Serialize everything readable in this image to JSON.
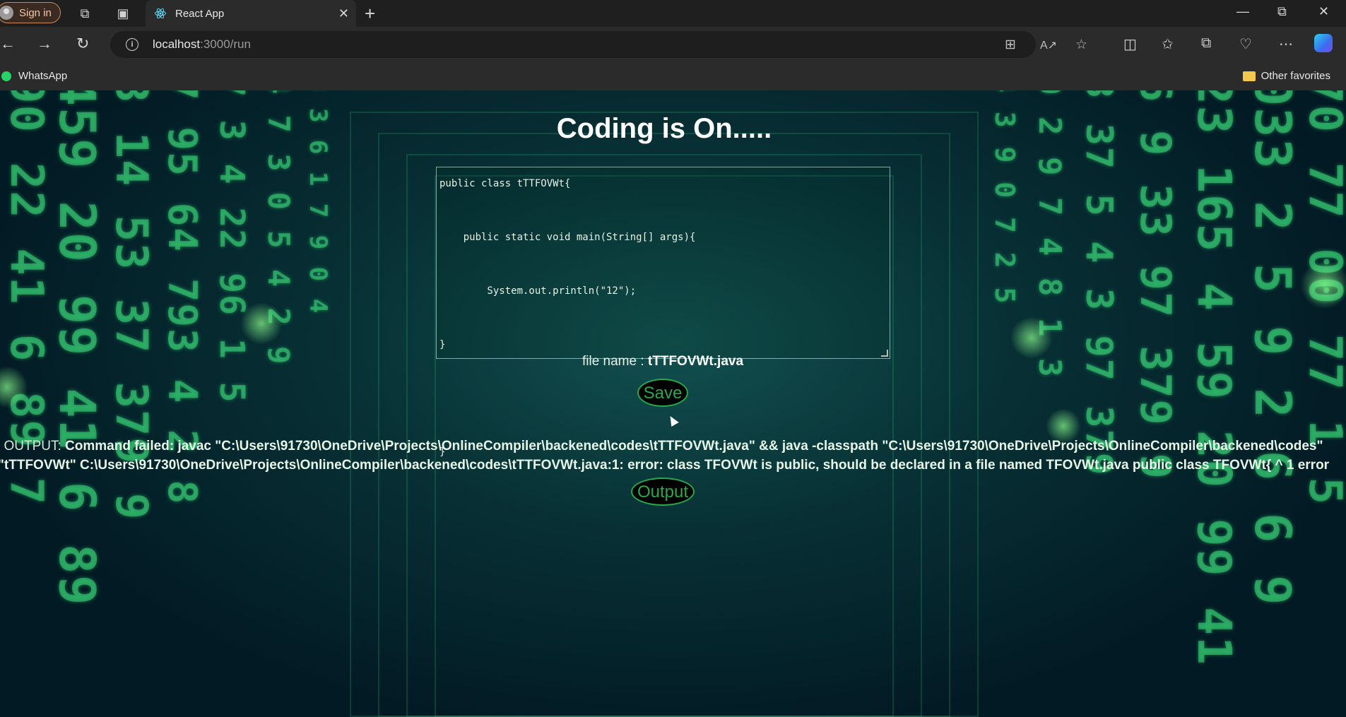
{
  "browser": {
    "signin_label": "Sign in",
    "tab_title": "React App",
    "url_host": "localhost",
    "url_path": ":3000/run",
    "bookmarks": {
      "left": "WhatsApp",
      "right": "Other favorites"
    }
  },
  "page": {
    "title": "Coding is On.....",
    "code": "public class tTTFOVWt{\n\n    public static void main(String[] args){\n\n        System.out.println(\"12\");\n\n}\n\n\n\n}",
    "save_label": "Save",
    "filename_label": "file name : ",
    "filename_value": "tTTFOVWt.java",
    "output_button_label": "Output",
    "output_label": "OUTPUT: ",
    "output_text": "Command failed: javac \"C:\\Users\\91730\\OneDrive\\Projects\\OnlineCompiler\\backened\\codes\\tTTFOVWt.java\" && java -classpath \"C:\\Users\\91730\\OneDrive\\Projects\\OnlineCompiler\\backened\\codes\" \"tTTFOVWt\" C:\\Users\\91730\\OneDrive\\Projects\\OnlineCompiler\\backened\\codes\\tTTFOVWt.java:1: error: class TFOVWt is public, should be declared in a file named TFOVWt.java public class TFOVWt{ ^ 1 error"
  },
  "icons": {
    "tab_favicon": "react-icon",
    "window": [
      "minimize-icon",
      "restore-icon",
      "close-icon"
    ]
  },
  "colors": {
    "button_text": "#2aa84a",
    "button_bg": "#000000",
    "title": "#ffffff"
  }
}
